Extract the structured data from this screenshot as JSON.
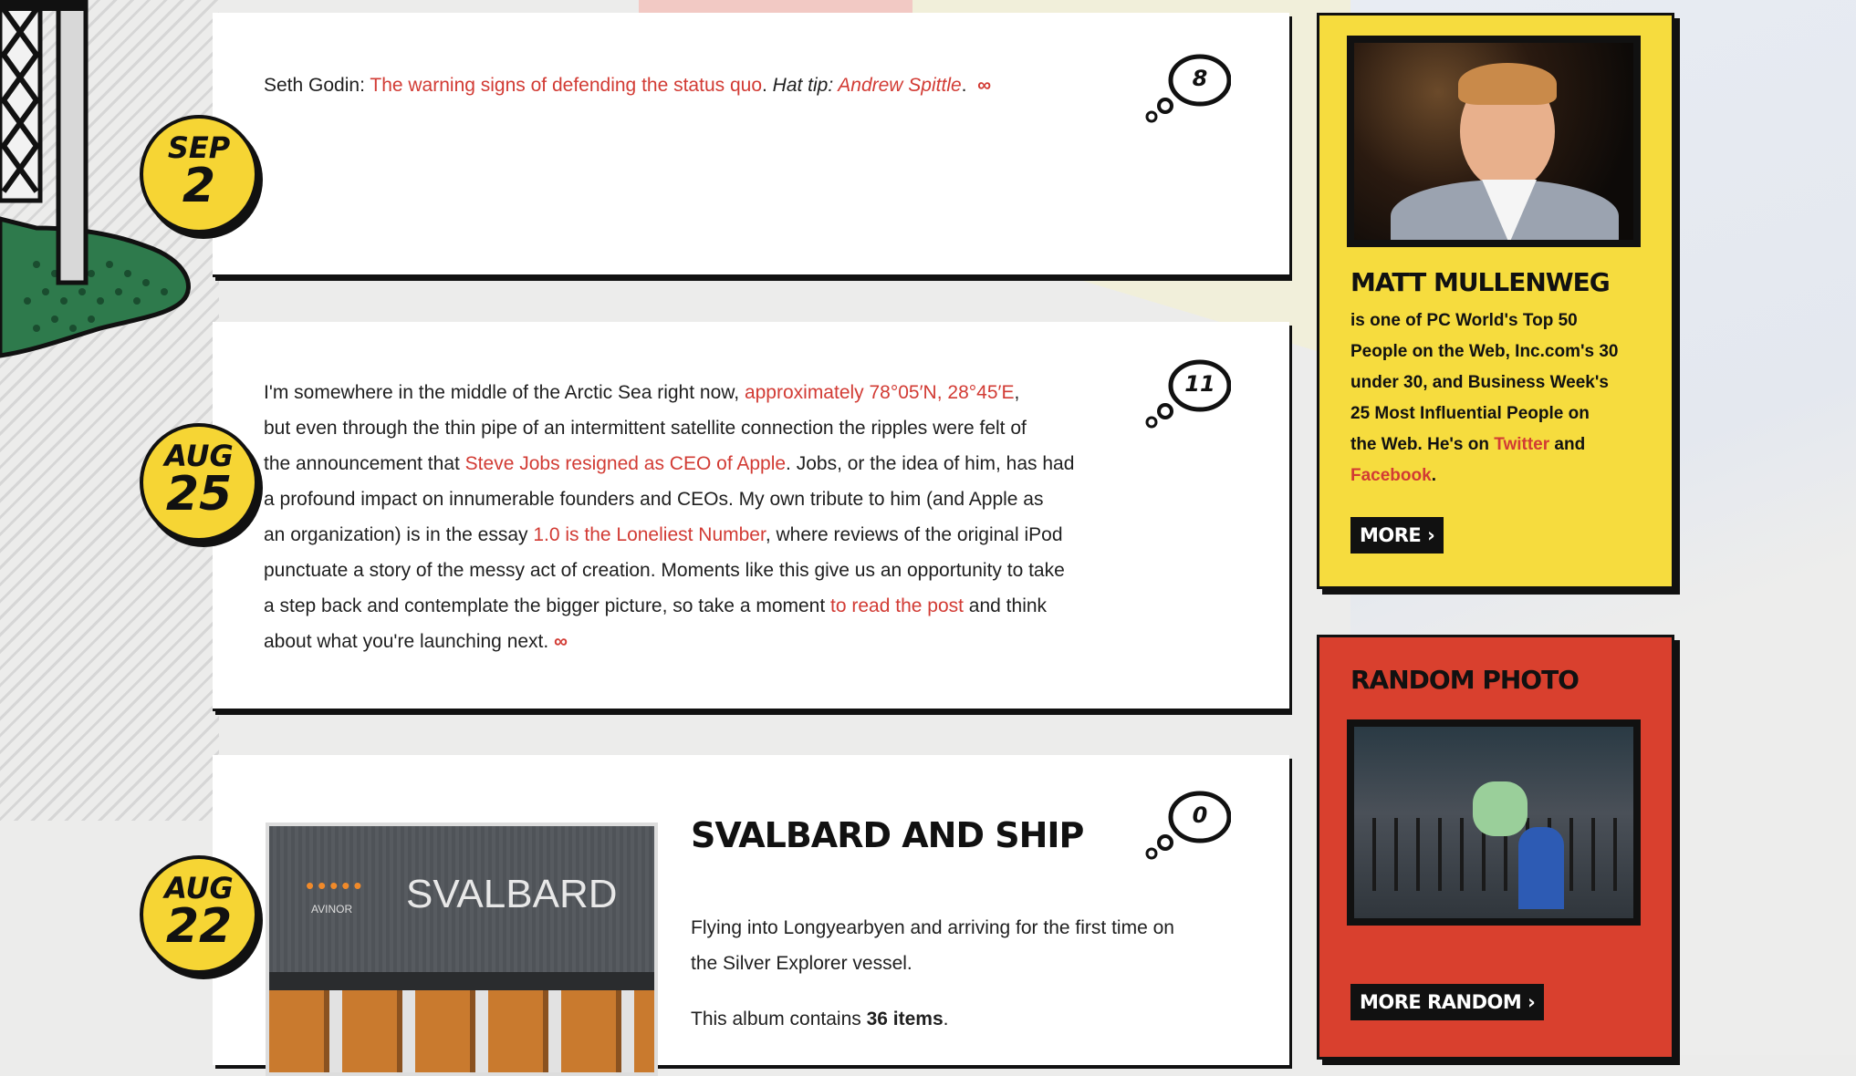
{
  "posts": [
    {
      "date": {
        "month": "SEP",
        "day": "2"
      },
      "comment_count": "8",
      "text": {
        "prefix": "Seth Godin: ",
        "link": "The warning signs of defending the status quo",
        "sep": ". ",
        "hat_tip_label": "Hat tip: ",
        "hat_tip_link": "Andrew Spittle",
        "end": ".",
        "permalink": "∞"
      }
    },
    {
      "date": {
        "month": "AUG",
        "day": "25"
      },
      "comment_count": "11",
      "lines": [
        [
          "I'm somewhere in the middle of the Arctic Sea right now, ",
          "approximately 78°05′N, 28°45′E",
          ","
        ],
        [
          "but even through the thin pipe of an intermittent satellite connection the ripples were felt of"
        ],
        [
          "the announcement that ",
          "Steve Jobs resigned as CEO of Apple",
          ". Jobs, or the idea of him, has had"
        ],
        [
          "a profound impact on innumerable founders and CEOs. My own tribute to him (and Apple as"
        ],
        [
          "an organization) is in the essay ",
          "1.0 is the Loneliest Number",
          ", where reviews of the original iPod"
        ],
        [
          "punctuate a story of the messy act of creation. Moments like this give us an opportunity to take"
        ],
        [
          "a step back and contemplate the bigger picture, so take a moment ",
          "to read the post",
          " and think"
        ],
        [
          "about what you're launching next.  "
        ]
      ],
      "permalink": "∞"
    },
    {
      "date": {
        "month": "AUG",
        "day": "22"
      },
      "comment_count": "0",
      "title": "SVALBARD AND SHIP",
      "description_line1": "Flying into Longyearbyen and arriving for the first time on",
      "description_line2": "the Silver Explorer vessel.",
      "album_prefix": "This album contains ",
      "album_count": "36 items",
      "album_suffix": ".",
      "photo": {
        "brand": "AVINOR",
        "sign": "SVALBARD"
      }
    }
  ],
  "profile": {
    "name": "MATT MULLENWEG",
    "bio_lines": [
      "is one of PC World's Top 50",
      "People on the Web, Inc.com's 30",
      "under 30, and Business Week's",
      "25 Most Influential People on"
    ],
    "bio_last_prefix": "the Web. He's on ",
    "twitter": "Twitter",
    "and": " and",
    "facebook": "Facebook",
    "period": ".",
    "more_label": "MORE ›"
  },
  "random_photo": {
    "title": "RANDOM PHOTO",
    "more_label": "MORE RANDOM ›"
  },
  "colors": {
    "yellow": "#f6dc3e",
    "red": "#d9402e",
    "link": "#d23b34"
  }
}
